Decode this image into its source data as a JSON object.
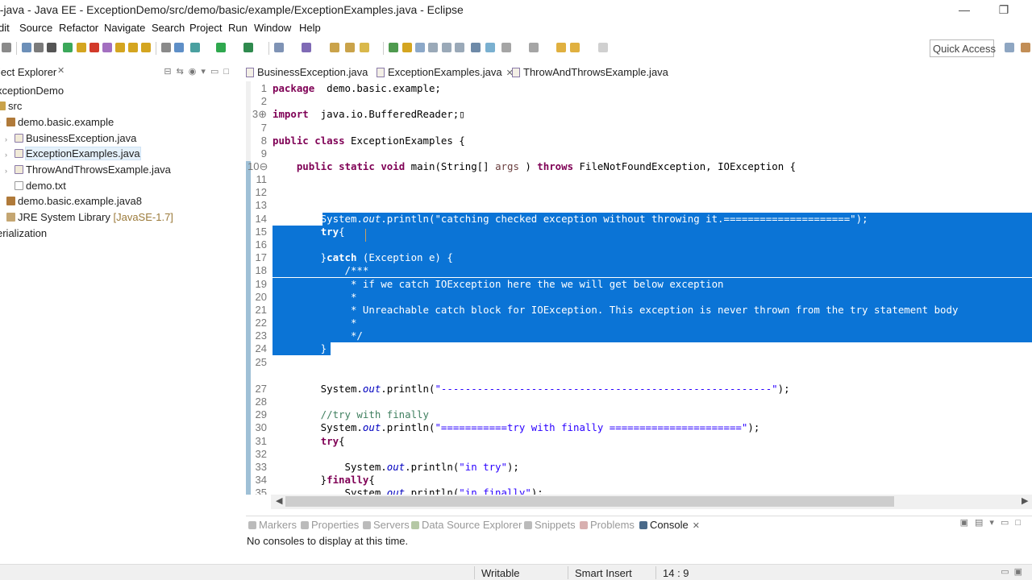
{
  "window": {
    "title": "e-java - Java EE - ExceptionDemo/src/demo/basic/example/ExceptionExamples.java - Eclipse",
    "minimize_glyph": "—",
    "restore_glyph": "❐"
  },
  "menu": [
    "dit",
    "Source",
    "Refactor",
    "Navigate",
    "Search",
    "Project",
    "Run",
    "Window",
    "Help"
  ],
  "toolbar": {
    "quick_access": "Quick Access"
  },
  "explorer": {
    "title": "ject Explorer",
    "close_glyph": "✕",
    "tree": [
      {
        "label": "xceptionDemo",
        "suffix": ""
      },
      {
        "label": "src",
        "suffix": ""
      },
      {
        "label": "demo.basic.example",
        "suffix": ""
      },
      {
        "label": "BusinessException.java",
        "suffix": ""
      },
      {
        "label": "ExceptionExamples.java",
        "suffix": ""
      },
      {
        "label": "ThrowAndThrowsExample.java",
        "suffix": ""
      },
      {
        "label": "demo.txt",
        "suffix": ""
      },
      {
        "label": "demo.basic.example.java8",
        "suffix": ""
      },
      {
        "label": "JRE System Library ",
        "suffix": "[JavaSE-1.7]"
      },
      {
        "label": "erialization",
        "suffix": ""
      }
    ]
  },
  "editor": {
    "tabs": [
      {
        "label": "BusinessException.java",
        "active": false
      },
      {
        "label": "ExceptionExamples.java",
        "active": true
      },
      {
        "label": "ThrowAndThrowsExample.java",
        "active": false
      }
    ],
    "tab_close_glyph": "✕",
    "lines": [
      {
        "n": "1",
        "segs": [
          [
            "kw",
            "package"
          ],
          [
            "",
            "  demo.basic.example;"
          ]
        ]
      },
      {
        "n": "2",
        "segs": []
      },
      {
        "n": "3⊕",
        "segs": [
          [
            "kw",
            "import"
          ],
          [
            "",
            "  java.io.BufferedReader;▯"
          ]
        ]
      },
      {
        "n": "7",
        "segs": []
      },
      {
        "n": "8",
        "segs": [
          [
            "kw",
            "public"
          ],
          [
            "",
            " "
          ],
          [
            "kw",
            "class"
          ],
          [
            "",
            " ExceptionExamples {"
          ]
        ]
      },
      {
        "n": "9",
        "segs": []
      },
      {
        "n": "10⊖",
        "segs": [
          [
            "",
            "    "
          ],
          [
            "kw",
            "public"
          ],
          [
            "",
            " "
          ],
          [
            "kw",
            "static"
          ],
          [
            "",
            " "
          ],
          [
            "kw",
            "void"
          ],
          [
            "",
            " main(String[] "
          ],
          [
            "arg",
            "args"
          ],
          [
            "",
            " ) "
          ],
          [
            "kw",
            "throws"
          ],
          [
            "",
            " FileNotFoundException, IOException {"
          ]
        ]
      },
      {
        "n": "11",
        "segs": []
      },
      {
        "n": "12",
        "segs": []
      },
      {
        "n": "13",
        "segs": []
      },
      {
        "n": "14",
        "segs": [
          [
            "",
            "        System."
          ],
          [
            "fld",
            "out"
          ],
          [
            "",
            ".println("
          ],
          [
            "str",
            "\"catching checked exception without throwing it.=====================\""
          ],
          [
            "",
            ");"
          ]
        ]
      },
      {
        "n": "15",
        "segs": [
          [
            "",
            "        "
          ],
          [
            "kw",
            "try"
          ],
          [
            "",
            "{"
          ]
        ]
      },
      {
        "n": "16",
        "segs": []
      },
      {
        "n": "17",
        "segs": [
          [
            "",
            "        }"
          ],
          [
            "kw",
            "catch"
          ],
          [
            "",
            " (Exception e) {"
          ]
        ]
      },
      {
        "n": "18",
        "segs": [
          [
            "jdoc",
            "            /***"
          ]
        ]
      },
      {
        "n": "19",
        "segs": [
          [
            "jdoc",
            "             * if we catch IOException here the we will get below exception"
          ]
        ]
      },
      {
        "n": "20",
        "segs": [
          [
            "jdoc",
            "             *"
          ]
        ]
      },
      {
        "n": "21",
        "segs": [
          [
            "jdoc",
            "             * Unreachable catch block for IOException. This exception is never thrown from the try statement body"
          ]
        ]
      },
      {
        "n": "22",
        "segs": [
          [
            "jdoc",
            "             *"
          ]
        ]
      },
      {
        "n": "23",
        "segs": [
          [
            "jdoc",
            "             */"
          ]
        ]
      },
      {
        "n": "24",
        "segs": [
          [
            "",
            "        }"
          ]
        ]
      },
      {
        "n": "25",
        "segs": []
      },
      {
        "n": "27",
        "segs": [
          [
            "",
            "        System."
          ],
          [
            "fld",
            "out"
          ],
          [
            "",
            ".println("
          ],
          [
            "str",
            "\"-------------------------------------------------------\""
          ],
          [
            "",
            ");"
          ]
        ]
      },
      {
        "n": "28",
        "segs": []
      },
      {
        "n": "29",
        "segs": [
          [
            "cmt",
            "        //try with finally"
          ]
        ]
      },
      {
        "n": "30",
        "segs": [
          [
            "",
            "        System."
          ],
          [
            "fld",
            "out"
          ],
          [
            "",
            ".println("
          ],
          [
            "str",
            "\"===========try with finally ======================\""
          ],
          [
            "",
            ");"
          ]
        ]
      },
      {
        "n": "31",
        "segs": [
          [
            "",
            "        "
          ],
          [
            "kw",
            "try"
          ],
          [
            "",
            "{"
          ]
        ]
      },
      {
        "n": "32",
        "segs": []
      },
      {
        "n": "33",
        "segs": [
          [
            "",
            "            System."
          ],
          [
            "fld",
            "out"
          ],
          [
            "",
            ".println("
          ],
          [
            "str",
            "\"in try\""
          ],
          [
            "",
            ");"
          ]
        ]
      },
      {
        "n": "34",
        "segs": [
          [
            "",
            "        }"
          ],
          [
            "kw",
            "finally"
          ],
          [
            "",
            "{"
          ]
        ]
      },
      {
        "n": "35",
        "segs": [
          [
            "",
            "            System."
          ],
          [
            "fld",
            "out"
          ],
          [
            "",
            ".println("
          ],
          [
            "str",
            "\"in finally\""
          ],
          [
            "",
            ");"
          ]
        ]
      }
    ]
  },
  "bottom_panel": {
    "tabs": [
      {
        "label": "Markers",
        "active": false
      },
      {
        "label": "Properties",
        "active": false
      },
      {
        "label": "Servers",
        "active": false
      },
      {
        "label": "Data Source Explorer",
        "active": false
      },
      {
        "label": "Snippets",
        "active": false
      },
      {
        "label": "Problems",
        "active": false
      },
      {
        "label": "Console",
        "active": true
      }
    ],
    "message": "No consoles to display at this time."
  },
  "status": {
    "writable": "Writable",
    "insert_mode": "Smart Insert",
    "position": "14 : 9"
  },
  "colors": {
    "selection": "#0b74d6",
    "keyword": "#7f0055",
    "string": "#2a00ff",
    "comment": "#3f7f5f",
    "javadoc": "#3f5fbf"
  }
}
